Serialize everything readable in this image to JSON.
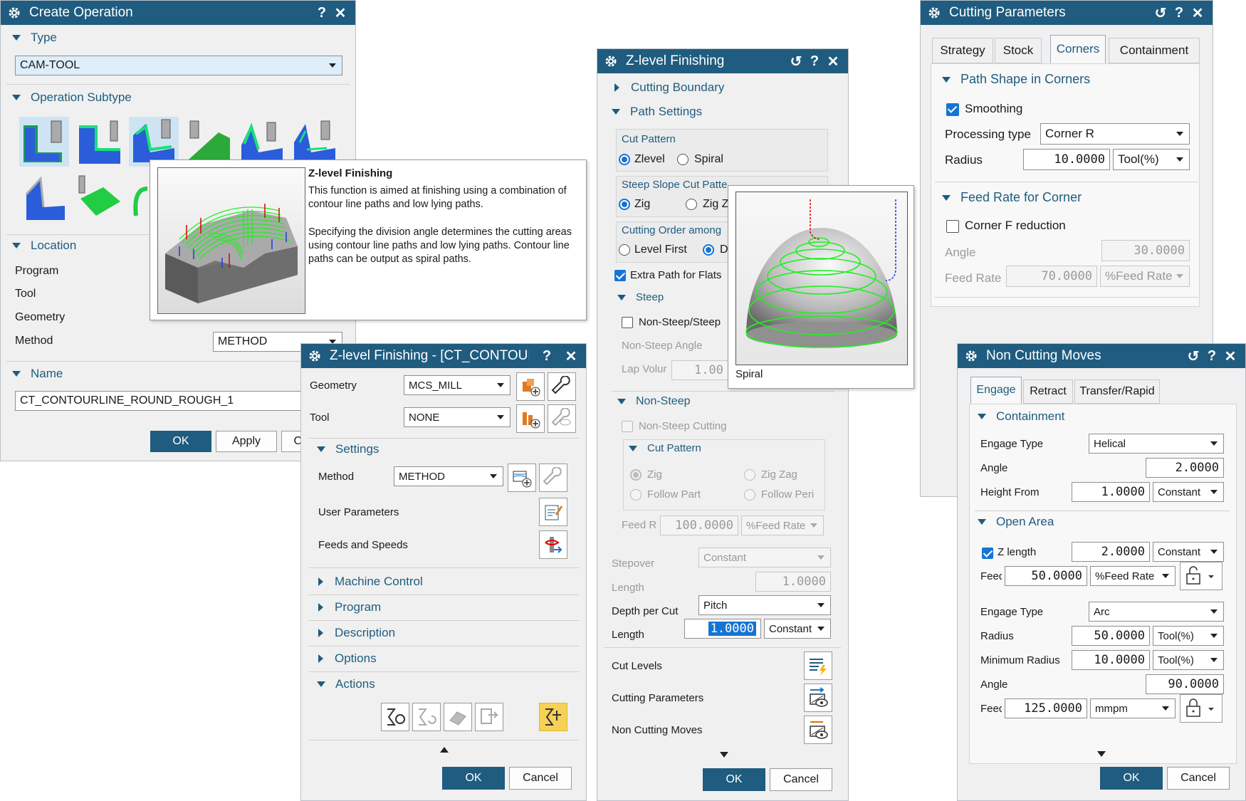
{
  "create_op": {
    "title": "Create Operation",
    "help": "?",
    "close": "✕",
    "type_label": "Type",
    "type_value": "CAM-TOOL",
    "subtype_label": "Operation Subtype",
    "location_label": "Location",
    "program_label": "Program",
    "tool_label": "Tool",
    "geometry_label": "Geometry",
    "method_label": "Method",
    "method_value": "METHOD",
    "name_label": "Name",
    "name_value": "CT_CONTOURLINE_ROUND_ROUGH_1",
    "ok": "OK",
    "apply": "Apply",
    "cancel_partial": "C"
  },
  "tooltip": {
    "title": "Z-level Finishing",
    "para1": "This function is aimed at finishing using a combination of contour line paths and low lying paths.",
    "para2": "Specifying the division angle determines the cutting areas using contour line paths and low lying paths. Contour line paths can be output as spiral paths."
  },
  "zlevel_ct": {
    "title": "Z-level Finishing - [CT_CONTOURL...",
    "help": "?",
    "close": "✕",
    "geometry_label": "Geometry",
    "geometry_value": "MCS_MILL",
    "tool_label": "Tool",
    "tool_value": "NONE",
    "settings_label": "Settings",
    "method_label": "Method",
    "method_value": "METHOD",
    "user_params_label": "User Parameters",
    "feeds_label": "Feeds and Speeds",
    "machine_control": "Machine Control",
    "program": "Program",
    "description": "Description",
    "options": "Options",
    "actions": "Actions",
    "ok": "OK",
    "cancel": "Cancel"
  },
  "zlevel": {
    "title": "Z-level Finishing",
    "reset": "↺",
    "help": "?",
    "close": "✕",
    "cutting_boundary": "Cutting Boundary",
    "path_settings": "Path Settings",
    "cut_pattern_label": "Cut Pattern",
    "zlevel_opt": "Zlevel",
    "spiral_opt": "Spiral",
    "steep_slope_label": "Steep Slope Cut Patte",
    "zig_opt": "Zig",
    "zigz_opt": "Zig Z",
    "cutting_order_label": "Cutting Order among",
    "level_first": "Level First",
    "d_opt": "D",
    "extra_path": "Extra Path for Flats",
    "steep_label": "Steep",
    "non_steep_steep": "Non-Steep/Steep",
    "non_steep_angle": "Non-Steep Angle",
    "lap_volume": "Lap Volur",
    "lap_value": "1.00",
    "non_steep_section": "Non-Steep",
    "non_steep_cutting": "Non-Steep Cutting",
    "cut_pattern_sub": "Cut Pattern",
    "zig2": "Zig",
    "zigzag": "Zig Zag",
    "follow_part": "Follow Part",
    "follow_peri": "Follow Peri",
    "feed_r": "Feed R",
    "feed_value": "100.0000",
    "feed_unit": "%Feed Rate",
    "stepover_label": "Stepover",
    "stepover_value": "Constant",
    "length_label": "Length",
    "length_value": "1.0000",
    "depth_label": "Depth per Cut",
    "depth_value": "Pitch",
    "length2_label": "Length",
    "length2_value": "1.0000",
    "length2_unit": "Constant",
    "cut_levels": "Cut Levels",
    "cutting_params": "Cutting Parameters",
    "non_cutting": "Non Cutting Moves",
    "ok": "OK",
    "cancel": "Cancel"
  },
  "spiral_tip": {
    "label": "Spiral"
  },
  "cutting_params": {
    "title": "Cutting Parameters",
    "reset": "↺",
    "help": "?",
    "close": "✕",
    "tabs": [
      "Strategy",
      "Stock",
      "Corners",
      "Containment"
    ],
    "path_shape": "Path Shape in Corners",
    "smoothing": "Smoothing",
    "processing_label": "Processing type",
    "processing_value": "Corner R",
    "radius_label": "Radius",
    "radius_value": "10.0000",
    "radius_unit": "Tool(%)",
    "feed_corner": "Feed Rate for Corner",
    "corner_f": "Corner F reduction",
    "angle_label": "Angle",
    "angle_value": "30.0000",
    "feed_rate_label": "Feed Rate",
    "feed_rate_value": "70.0000",
    "feed_rate_unit": "%Feed Rate"
  },
  "non_cutting": {
    "title": "Non Cutting Moves",
    "reset": "↺",
    "help": "?",
    "close": "✕",
    "tabs": [
      "Engage",
      "Retract",
      "Transfer/Rapid"
    ],
    "containment": "Containment",
    "engage_type_label": "Engage Type",
    "engage_type_value": "Helical",
    "angle_label": "Angle",
    "angle_value": "2.0000",
    "height_label": "Height From",
    "height_value": "1.0000",
    "height_unit": "Constant",
    "open_area": "Open Area",
    "z_length_label": "Z length",
    "z_length_value": "2.0000",
    "z_length_unit": "Constant",
    "feed_label": "Feed",
    "feed_value": "50.0000",
    "feed_unit": "%Feed Rate",
    "engage_type2_label": "Engage Type",
    "engage_type2_value": "Arc",
    "radius_label": "Radius",
    "radius_value": "50.0000",
    "radius_unit": "Tool(%)",
    "min_radius_label": "Minimum Radius",
    "min_radius_value": "10.0000",
    "min_radius_unit": "Tool(%)",
    "angle2_label": "Angle",
    "angle2_value": "90.0000",
    "feed2_label": "Feed",
    "feed2_value": "125.0000",
    "feed2_unit": "mmpm",
    "ok": "OK",
    "cancel": "Cancel"
  },
  "colors": {
    "title_bar": "#1f5c7f",
    "accent_text": "#1f5c7f",
    "primary_button": "#1f5c7f",
    "check_blue": "#1574d4",
    "path_green": "#22dd22"
  }
}
